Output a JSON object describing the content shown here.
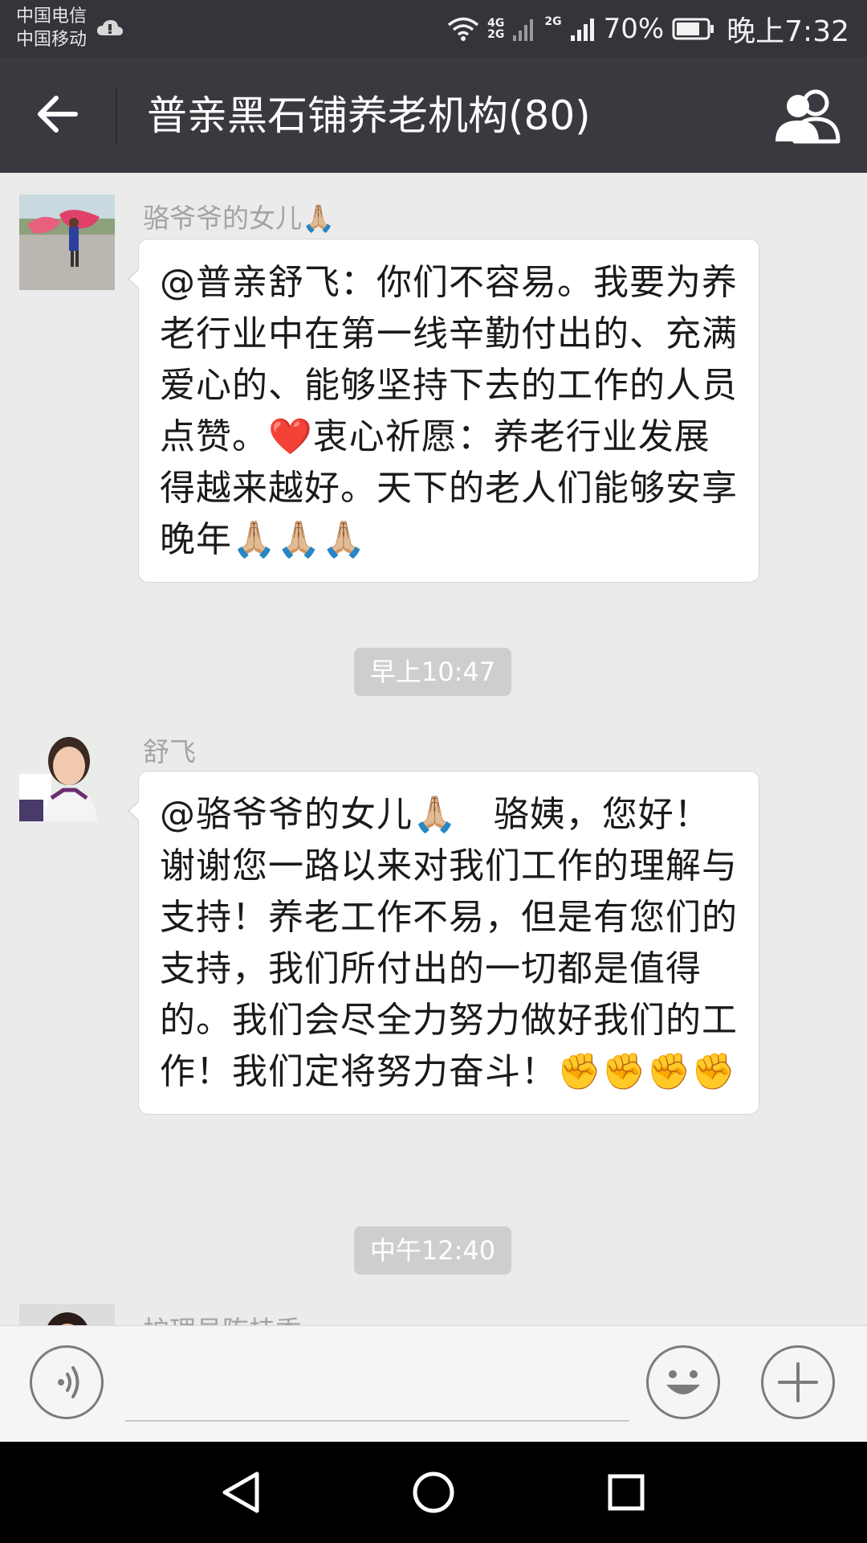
{
  "status_bar": {
    "carrier1": "中国电信",
    "carrier2": "中国移动",
    "net1": "4G",
    "net2": "2G",
    "net3": "2G",
    "battery": "70%",
    "time": "晚上7:32"
  },
  "header": {
    "title": "普亲黑石铺养老机构(80)"
  },
  "messages": [
    {
      "sender": "骆爷爷的女儿🙏🏼",
      "text": "@普亲舒飞：你们不容易。我要为养老行业中在第一线辛勤付出的、充满爱心的、能够坚持下去的工作的人员点赞。❤️衷心祈愿：养老行业发展得越来越好。天下的老人们能够安享晚年🙏🏼🙏🏼🙏🏼"
    },
    {
      "sender": "舒飞",
      "text": "@骆爷爷的女儿🙏🏼　骆姨，您好！谢谢您一路以来对我们工作的理解与支持！养老工作不易，但是有您们的支持，我们所付出的一切都是值得的。我们会尽全力努力做好我们的工作！我们定将努力奋斗！✊✊✊✊"
    },
    {
      "sender": "护理员陈桂秀"
    }
  ],
  "timestamps": [
    "早上10:47",
    "中午12:40"
  ],
  "input_bar": {
    "placeholder": ""
  },
  "colors": {
    "status_bar": "#33353a",
    "title_bar": "#393a3f",
    "chat_bg": "#ebebeb",
    "bubble": "#ffffff"
  }
}
